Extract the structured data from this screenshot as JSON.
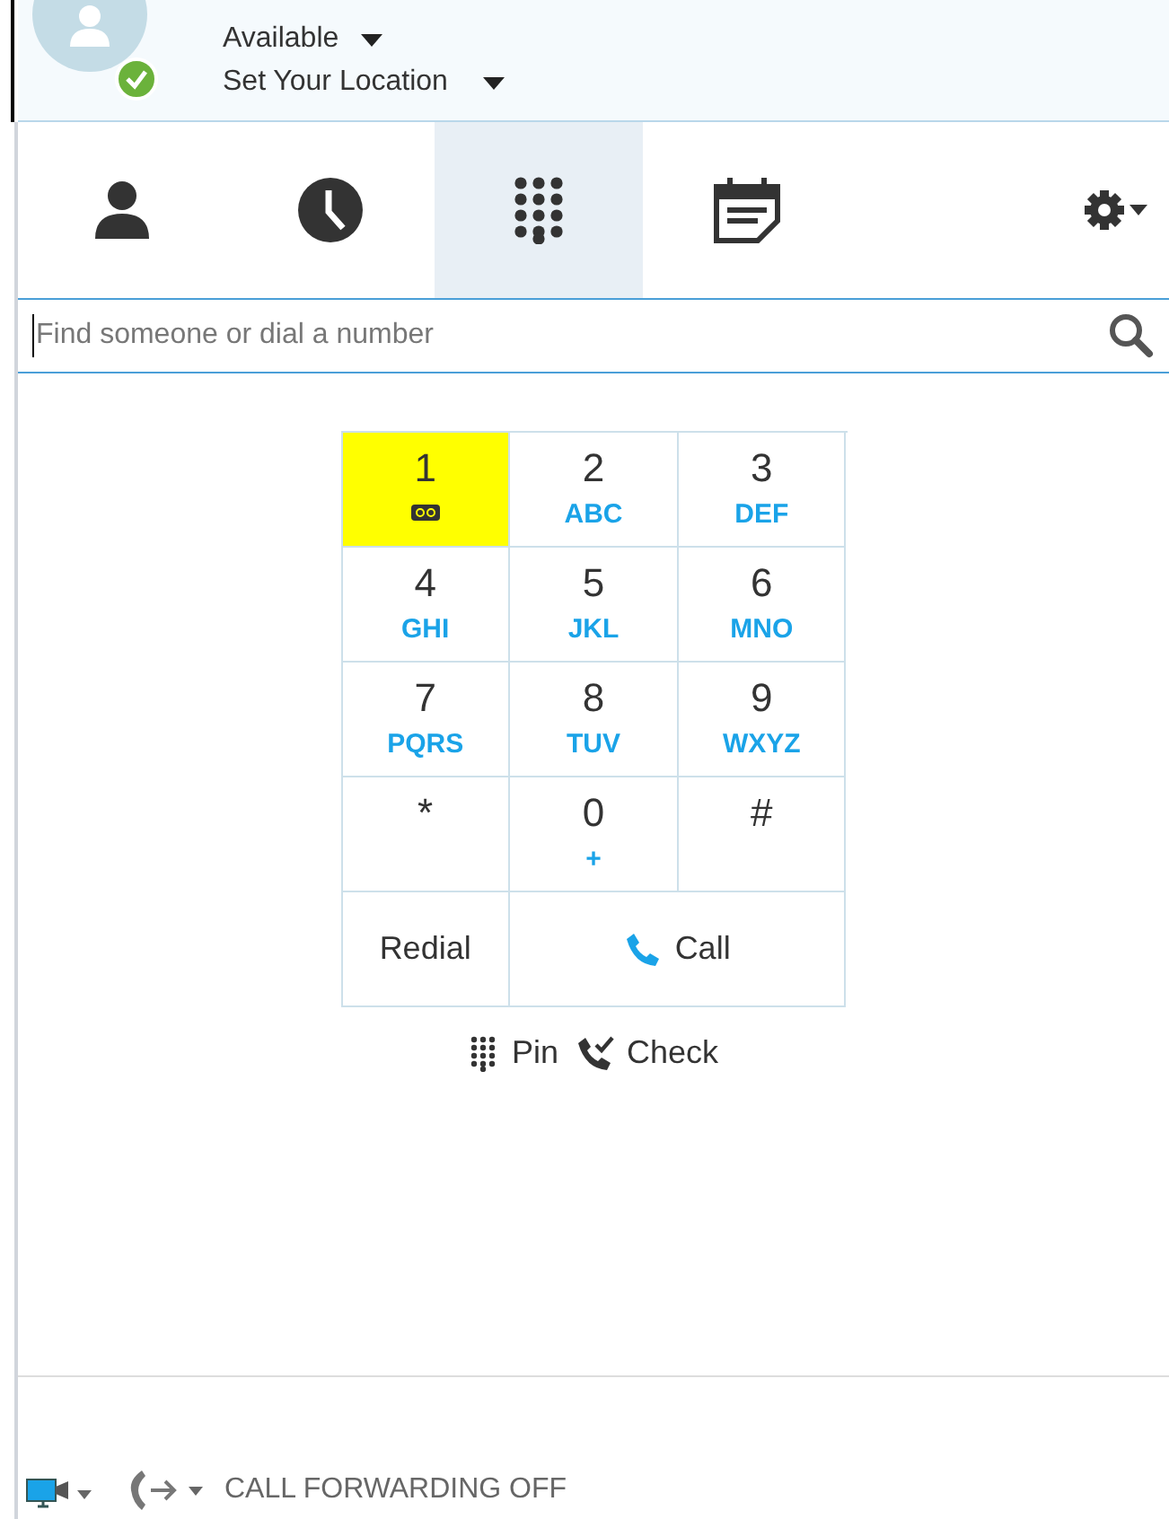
{
  "status": {
    "presence": "Available",
    "location": "Set Your Location",
    "online": true
  },
  "tabs": [
    {
      "kind": "contacts",
      "selected": false
    },
    {
      "kind": "recent",
      "selected": false
    },
    {
      "kind": "dialpad",
      "selected": true
    },
    {
      "kind": "meetings",
      "selected": false
    }
  ],
  "search": {
    "placeholder": "Find someone or dial a number"
  },
  "keys": [
    {
      "digit": "1",
      "kind": "voicemail",
      "highlighted": true
    },
    {
      "digit": "2",
      "letters": "ABC",
      "highlighted": false
    },
    {
      "digit": "3",
      "letters": "DEF",
      "highlighted": false
    },
    {
      "digit": "4",
      "letters": "GHI",
      "highlighted": false
    },
    {
      "digit": "5",
      "letters": "JKL",
      "highlighted": false
    },
    {
      "digit": "6",
      "letters": "MNO",
      "highlighted": false
    },
    {
      "digit": "7",
      "letters": "PQRS",
      "highlighted": false
    },
    {
      "digit": "8",
      "letters": "TUV",
      "highlighted": false
    },
    {
      "digit": "9",
      "letters": "WXYZ",
      "highlighted": false
    },
    {
      "digit": "*",
      "highlighted": false
    },
    {
      "digit": "0",
      "letters": "+",
      "highlighted": false
    },
    {
      "digit": "#",
      "highlighted": false
    }
  ],
  "actions": {
    "redial": "Redial",
    "call": "Call"
  },
  "links": {
    "pin": "Pin",
    "check": "Check"
  },
  "footer": {
    "forwarding": "CALL FORWARDING OFF"
  }
}
